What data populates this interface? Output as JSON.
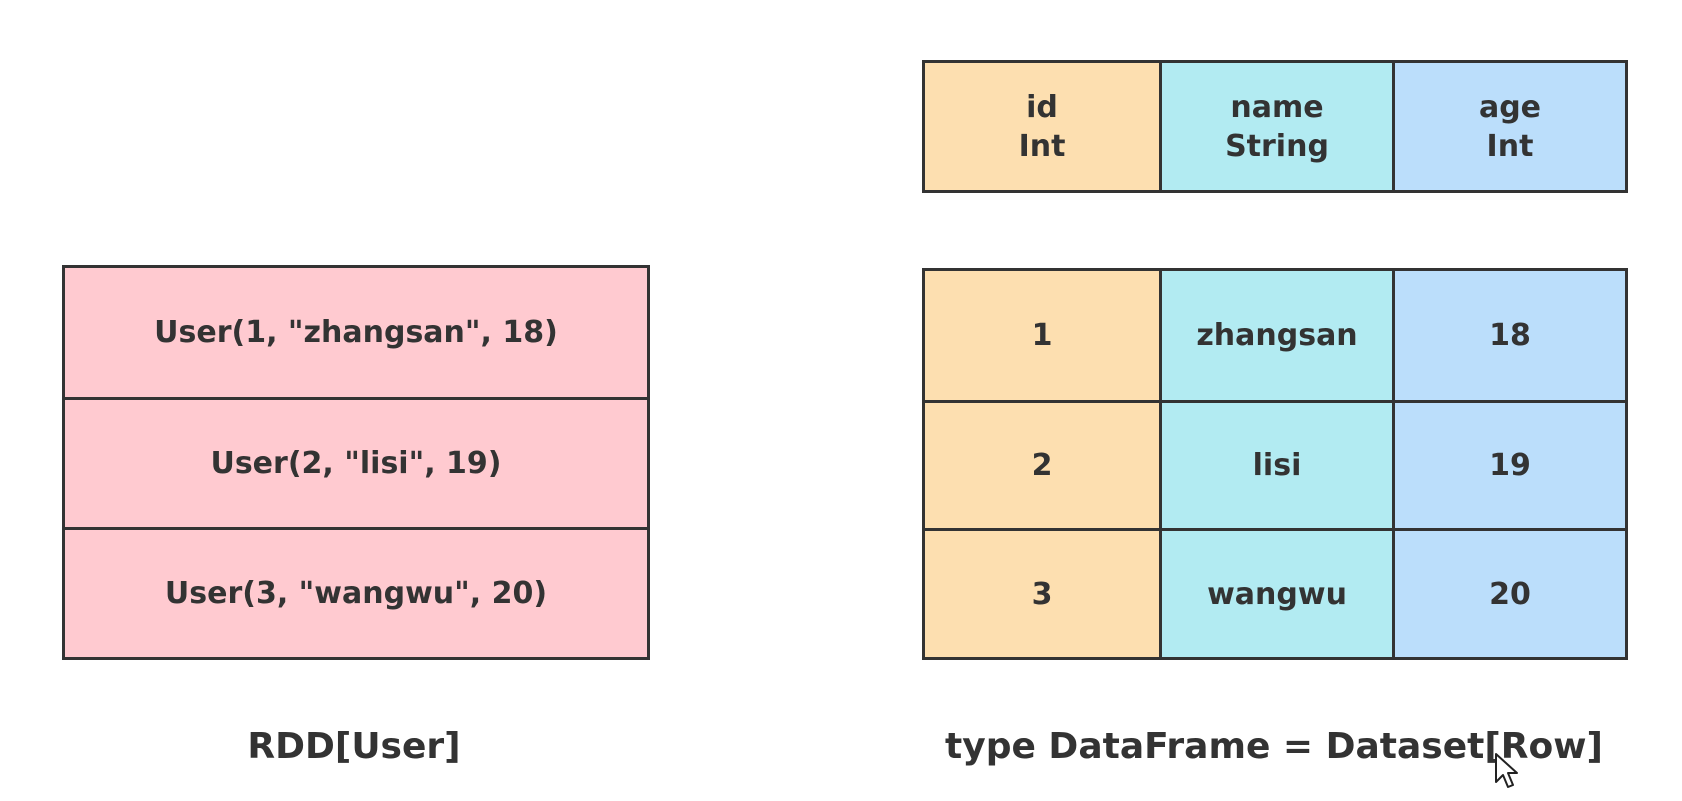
{
  "rdd": {
    "rows": [
      "User(1, \"zhangsan\", 18)",
      "User(2, \"lisi\", 19)",
      "User(3, \"wangwu\", 20)"
    ],
    "caption": "RDD[User]",
    "color": "#ffcad0"
  },
  "dataframe": {
    "columns": [
      {
        "name": "id",
        "type": "Int",
        "color": "#fddfb0"
      },
      {
        "name": "name",
        "type": "String",
        "color": "#b2ebf2"
      },
      {
        "name": "age",
        "type": "Int",
        "color": "#bbdefb"
      }
    ],
    "rows": [
      [
        "1",
        "zhangsan",
        "18"
      ],
      [
        "2",
        "lisi",
        "19"
      ],
      [
        "3",
        "wangwu",
        "20"
      ]
    ],
    "caption": "type DataFrame = Dataset[Row]"
  },
  "cursor": "mouse-pointer-icon"
}
